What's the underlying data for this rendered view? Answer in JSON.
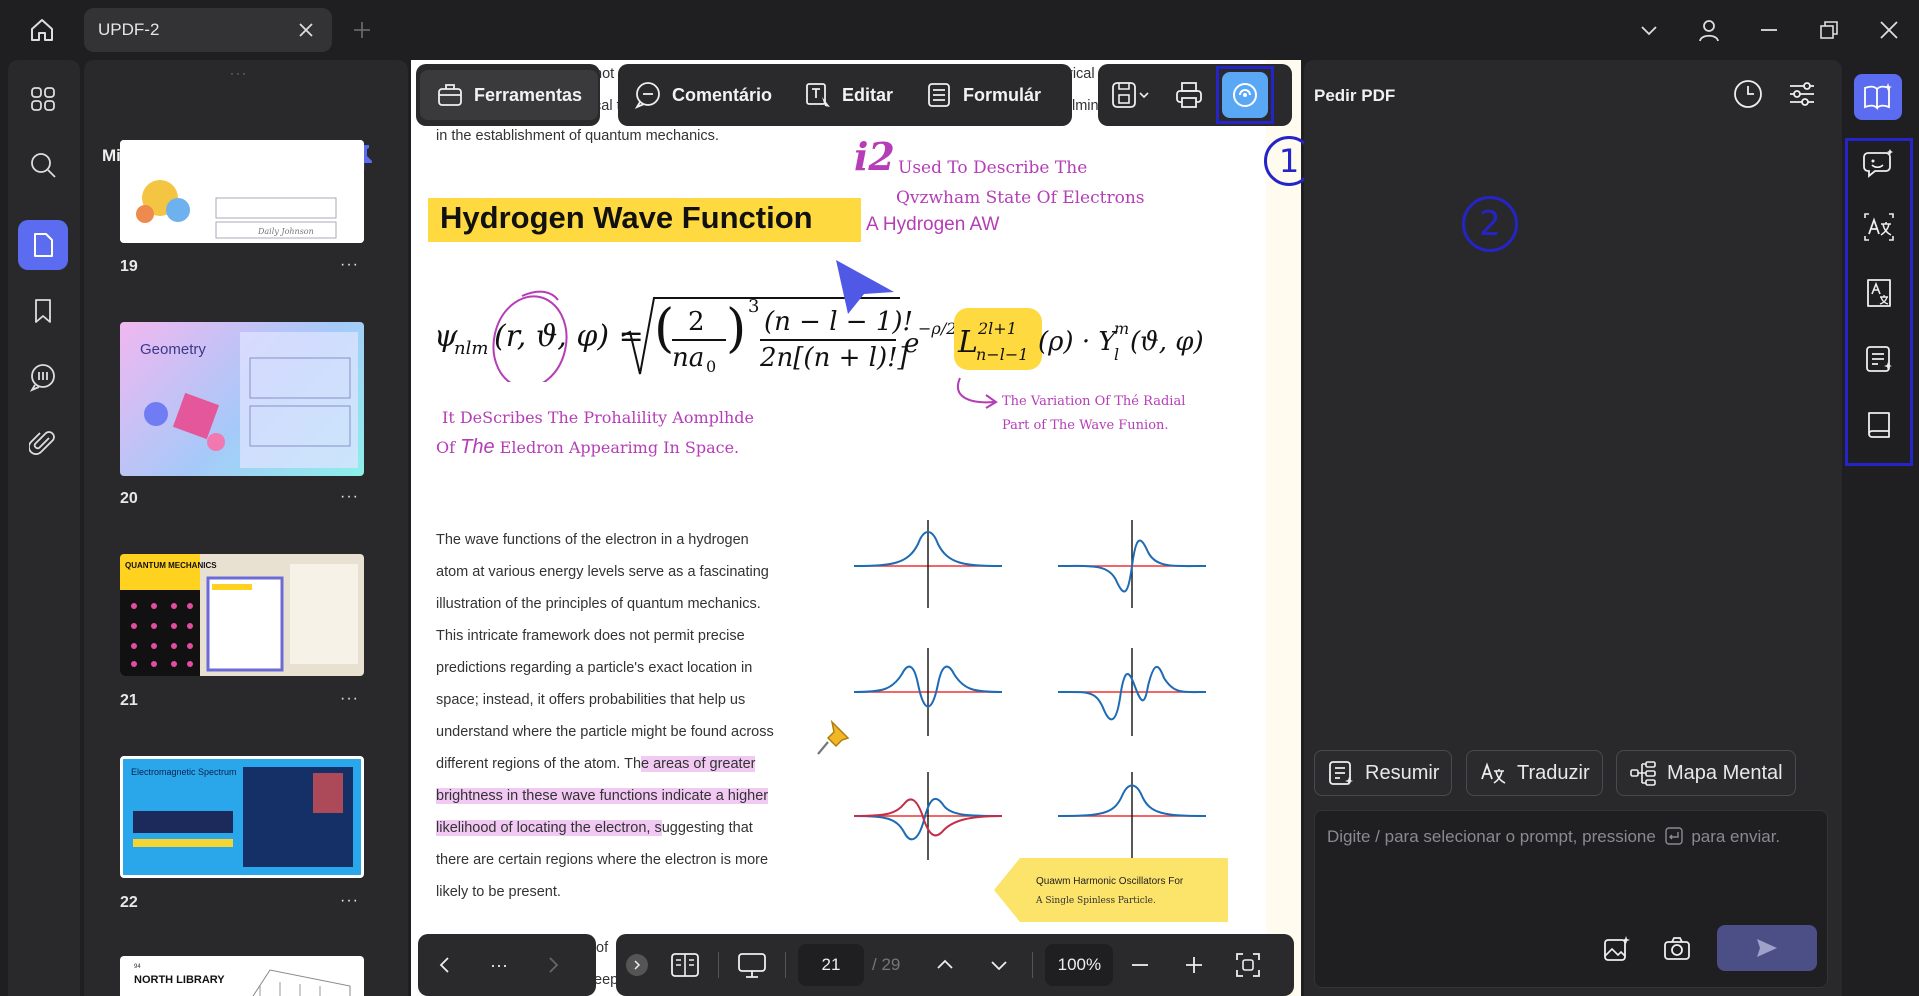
{
  "titlebar": {
    "tab_title": "UPDF-2"
  },
  "thumbnails": {
    "title": "Miniaturas",
    "pages": [
      {
        "num": "19",
        "more": "···"
      },
      {
        "num": "20",
        "more": "···",
        "thumb_label": "Geometry"
      },
      {
        "num": "21",
        "more": "···",
        "thumb_label": "QUANTUM MECHANICS"
      },
      {
        "num": "22",
        "more": "···",
        "thumb_label": "Electromagnetic Spectrum"
      },
      {
        "thumb_label": "NORTH LIBRARY",
        "thumb_sub": "94"
      }
    ],
    "signature_text": "Daily Johnson"
  },
  "toolbar": {
    "tools": "Ferramentas",
    "comment": "Comentário",
    "edit": "Editar",
    "form": "Formulár"
  },
  "document": {
    "top_line": "in the establishment of quantum mechanics.",
    "peek_1": "not",
    "peek_2": "cal t",
    "peek_3": "rical",
    "peek_4": "lmin",
    "title": "Hydrogen Wave Function",
    "annotation_top_i2": "i2",
    "annotation_top_1": "Used To Describe The",
    "annotation_top_2": "Qvzwham State Of Electrons",
    "annotation_top_3": "A Hydrogen AW",
    "annotation_left_1": "It DeScribes The Prohalility Aomplhde",
    "annotation_left_2a": "Of ",
    "annotation_left_2b": "The",
    "annotation_left_2c": " Eledron Appearimg In Space.",
    "annotation_right_1": "The Variation Of Thé Radial",
    "annotation_right_2": "Part of The Wave Funion.",
    "para_lines": [
      "The wave functions of the electron in a hydrogen",
      "atom at various energy levels serve as a fascinating",
      "illustration of the principles of quantum mechanics.",
      "This intricate framework does not permit precise",
      "predictions regarding a particle's exact location in",
      "space; instead, it offers probabilities that help us",
      "understand where the particle might be found across"
    ],
    "para_hl_1a": "different regions of the atom. Th",
    "para_hl_1b": "e areas of greater",
    "para_hl_2": "brightness in these wave functions indicate a higher",
    "para_hl_3a": "likelihood of locating the electron, s",
    "para_hl_3b": "uggesting that",
    "para_tail_1": "there are certain regions where the electron is more",
    "para_tail_2": "likely to be present.",
    "sticky_1": "Quawm Harmonic Oscillators For",
    "sticky_2": "A Single Spinless Particle.",
    "bottom_peek_1": "of",
    "bottom_peek_2": "eep"
  },
  "bottombar": {
    "more": "···",
    "page_current": "21",
    "page_total": "/ 29",
    "zoom": "100%"
  },
  "ai": {
    "title": "Pedir PDF",
    "chips": [
      "Resumir",
      "Traduzir",
      "Mapa Mental"
    ],
    "placeholder_a": "Digite / para selecionar o prompt, pressione",
    "placeholder_b": "para enviar."
  },
  "callouts": {
    "one": "1",
    "two": "2"
  },
  "colors": {
    "accent": "#5b6cf0",
    "highlight_yellow": "#ffd940",
    "highlight_pink": "#f1c9f3",
    "handwriting": "#b53db7",
    "callout_blue": "#2424c9"
  }
}
